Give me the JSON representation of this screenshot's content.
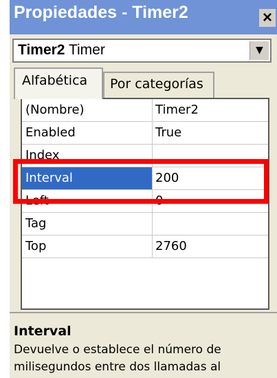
{
  "window": {
    "title": "Propiedades - Timer2",
    "close_symbol": "×"
  },
  "object_selector": {
    "object_name": "Timer2",
    "object_type": "Timer",
    "dropdown_icon": "chevron-down-icon"
  },
  "tabs": [
    {
      "label": "Alfabética",
      "active": true
    },
    {
      "label": "Por categorías",
      "active": false
    }
  ],
  "properties": [
    {
      "name": "(Nombre)",
      "value": "Timer2",
      "selected": false
    },
    {
      "name": "Enabled",
      "value": "True",
      "selected": false
    },
    {
      "name": "Index",
      "value": "",
      "selected": false
    },
    {
      "name": "Interval",
      "value": "200",
      "selected": true
    },
    {
      "name": "Left",
      "value": "0",
      "selected": false
    },
    {
      "name": "Tag",
      "value": "",
      "selected": false
    },
    {
      "name": "Top",
      "value": "2760",
      "selected": false
    }
  ],
  "description": {
    "title": "Interval",
    "text": "Devuelve o establece el número de milisegundos entre dos llamadas al"
  },
  "colors": {
    "title_bar": "#6f93d6",
    "selection": "#316ac5",
    "highlight": "#ff0000",
    "panel": "#ece9d8"
  }
}
